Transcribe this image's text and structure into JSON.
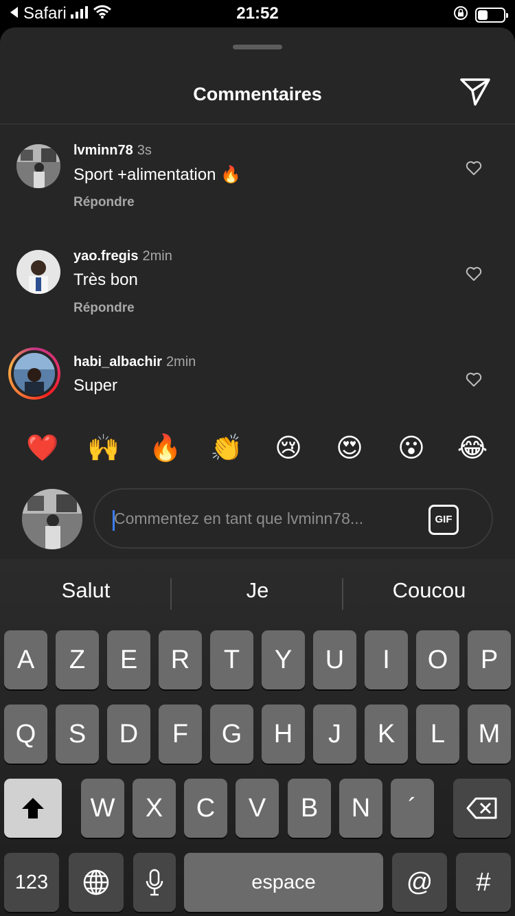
{
  "status_bar": {
    "back_app": "Safari",
    "time": "21:52"
  },
  "sheet": {
    "title": "Commentaires"
  },
  "comments": [
    {
      "username": "lvminn78",
      "time": "3s",
      "text": "Sport +alimentation 🔥",
      "reply_label": "Répondre"
    },
    {
      "username": "yao.fregis",
      "time": "2min",
      "text": "Très bon",
      "reply_label": "Répondre"
    },
    {
      "username": "habi_albachir",
      "time": "2min",
      "text": "Super"
    }
  ],
  "emoji_bar": [
    "❤️",
    "🙌",
    "🔥",
    "👏",
    "😢",
    "😍",
    "😮",
    "😂"
  ],
  "comment_input": {
    "placeholder": "Commentez en tant que lvminn78...",
    "gif_label": "GIF"
  },
  "keyboard": {
    "suggestions": [
      "Salut",
      "Je",
      "Coucou"
    ],
    "row1": [
      "A",
      "Z",
      "E",
      "R",
      "T",
      "Y",
      "U",
      "I",
      "O",
      "P"
    ],
    "row2": [
      "Q",
      "S",
      "D",
      "F",
      "G",
      "H",
      "J",
      "K",
      "L",
      "M"
    ],
    "row3": [
      "W",
      "X",
      "C",
      "V",
      "B",
      "N",
      "´"
    ],
    "numbers_label": "123",
    "space_label": "espace",
    "at_label": "@",
    "hash_label": "#"
  }
}
